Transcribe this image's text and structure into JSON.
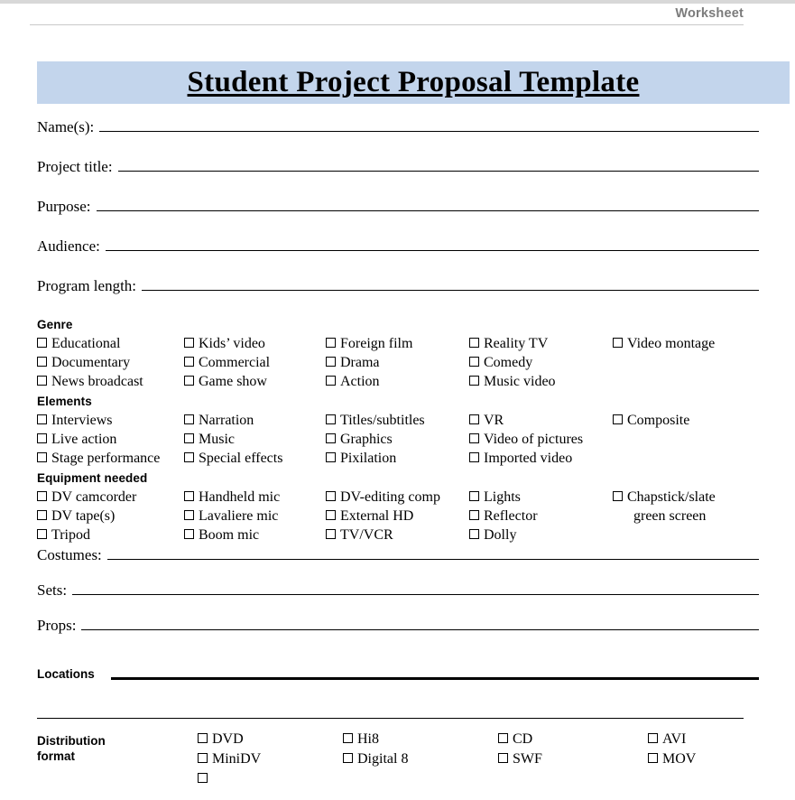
{
  "header": {
    "label": "Worksheet"
  },
  "title": {
    "text": "Student Project Proposal Template"
  },
  "fields_top": [
    {
      "label": "Name(s):"
    },
    {
      "label": "Project title:"
    },
    {
      "label": "Purpose:"
    },
    {
      "label": "Audience:"
    },
    {
      "label": "Program length:"
    }
  ],
  "sections": [
    {
      "title": "Genre",
      "columns": [
        {
          "items": [
            "Educational",
            "Documentary",
            "News broadcast"
          ]
        },
        {
          "items": [
            "Kids’ video",
            "Commercial",
            "Game show"
          ]
        },
        {
          "items": [
            "Foreign film",
            "Drama",
            "Action"
          ]
        },
        {
          "items": [
            "Reality TV",
            "Comedy",
            "Music video"
          ]
        },
        {
          "items": [
            "Video montage"
          ]
        }
      ]
    },
    {
      "title": "Elements",
      "columns": [
        {
          "items": [
            "Interviews",
            "Live action",
            "Stage performance"
          ]
        },
        {
          "items": [
            "Narration",
            " Music",
            "Special effects"
          ]
        },
        {
          "items": [
            "Titles/subtitles",
            "Graphics",
            "Pixilation"
          ]
        },
        {
          "items": [
            "VR",
            "Video of pictures",
            "Imported video"
          ]
        },
        {
          "items": [
            "Composite"
          ]
        }
      ]
    },
    {
      "title": "Equipment needed",
      "columns": [
        {
          "items": [
            "DV camcorder",
            "DV tape(s)",
            "Tripod"
          ]
        },
        {
          "items": [
            "Handheld mic",
            "Lavaliere mic",
            "Boom mic"
          ]
        },
        {
          "items": [
            "DV-editing comp",
            "External HD",
            "TV/VCR"
          ]
        },
        {
          "items": [
            "Lights",
            "Reflector",
            "Dolly"
          ]
        },
        {
          "items": [
            "Chapstick/slate"
          ],
          "subline": "green screen"
        }
      ]
    }
  ],
  "fields_bottom": [
    {
      "label": "Costumes:"
    },
    {
      "label": "Sets:"
    },
    {
      "label": "Props:"
    }
  ],
  "locations": {
    "label": "Locations"
  },
  "distribution": {
    "label_line1": "Distribution",
    "label_line2": "format",
    "columns": [
      {
        "items": [
          "DVD",
          "MiniDV"
        ]
      },
      {
        "items": [
          "Hi8",
          "Digital 8"
        ]
      },
      {
        "items": [
          "CD",
          "SWF"
        ]
      },
      {
        "items": [
          "AVI",
          "MOV"
        ]
      }
    ]
  },
  "colors": {
    "banner": "#c3d5ec",
    "header_text": "#7b7b7b",
    "rule": "#000000"
  }
}
